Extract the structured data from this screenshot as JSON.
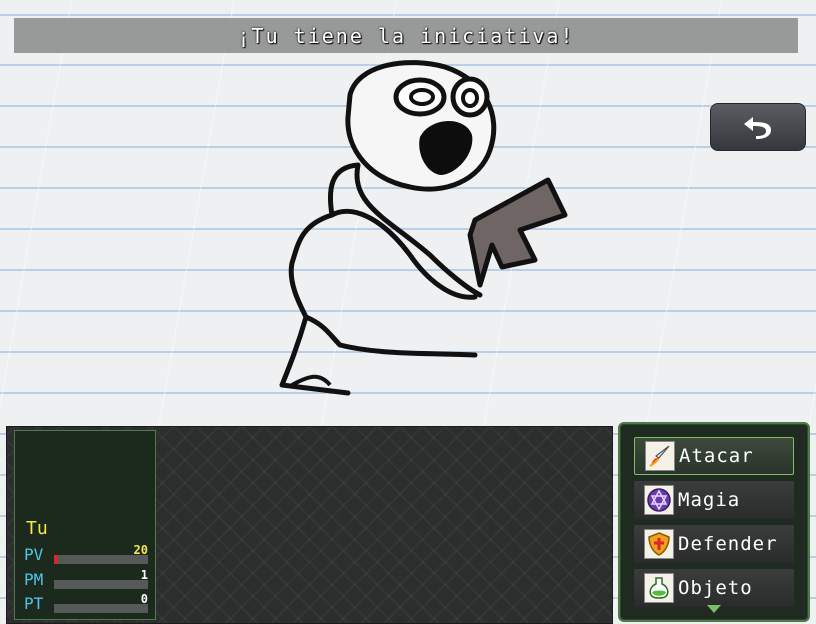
{
  "message": {
    "text": "¡Tu tiene la iniciativa!"
  },
  "back_button": {
    "icon": "undo-arrow-icon"
  },
  "enemy": {
    "description_icon": "stick-figure-with-gun"
  },
  "actor": {
    "name": "Tu",
    "stats": [
      {
        "label": "PV",
        "value": "20",
        "fill_fraction": 0.04,
        "color": "#d8262b"
      },
      {
        "label": "PM",
        "value": "1",
        "fill_fraction": 0.0,
        "color": "#3a7bd5"
      },
      {
        "label": "PT",
        "value": "0",
        "fill_fraction": 0.0,
        "color": "#3aa34a"
      }
    ]
  },
  "commands": [
    {
      "label": "Atacar",
      "icon": "sword-icon",
      "selected": true
    },
    {
      "label": "Magia",
      "icon": "pentagram-icon",
      "selected": false
    },
    {
      "label": "Defender",
      "icon": "shield-icon",
      "selected": false
    },
    {
      "label": "Objeto",
      "icon": "potion-icon",
      "selected": false
    }
  ],
  "colors": {
    "accent_green": "#7fbf62",
    "hp_label": "#4fc6e8",
    "name": "#f4e84a"
  }
}
